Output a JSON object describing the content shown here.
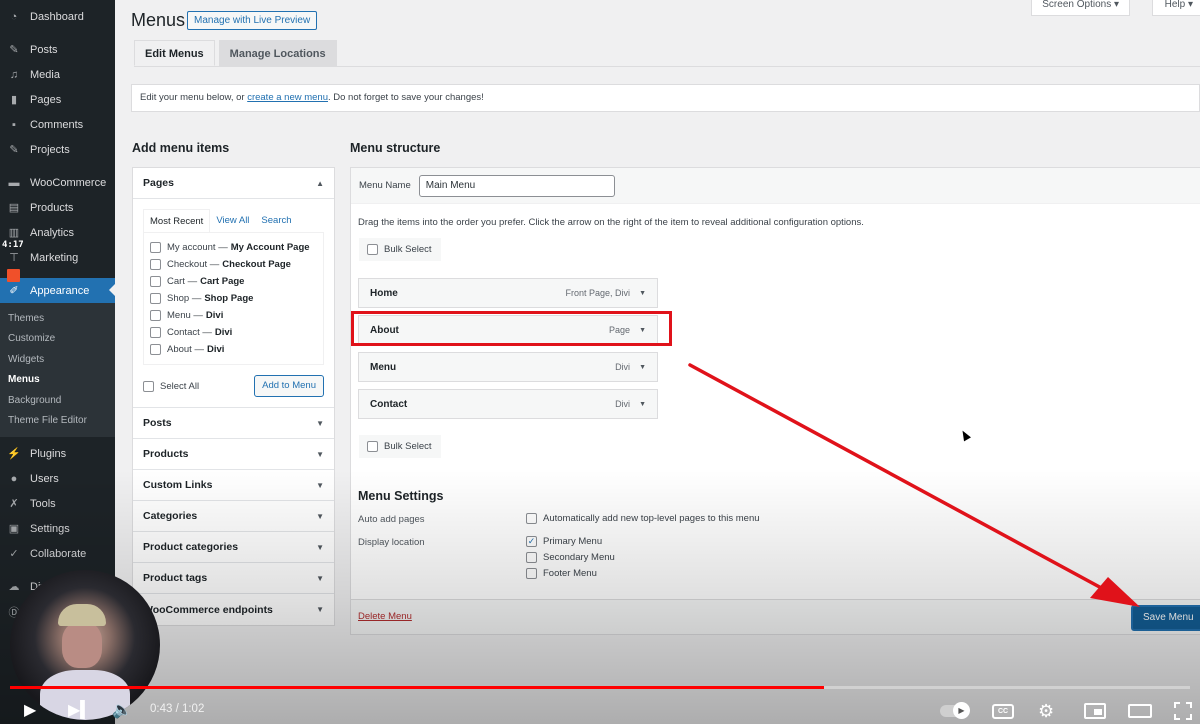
{
  "sidebar": {
    "items": [
      {
        "label": "Dashboard",
        "icon": "dashboard-icon"
      },
      {
        "label": "Posts",
        "icon": "pin-icon"
      },
      {
        "label": "Media",
        "icon": "media-icon"
      },
      {
        "label": "Pages",
        "icon": "pages-icon"
      },
      {
        "label": "Comments",
        "icon": "comment-icon"
      },
      {
        "label": "Projects",
        "icon": "pin-icon"
      },
      {
        "label": "WooCommerce",
        "icon": "woocommerce-icon"
      },
      {
        "label": "Products",
        "icon": "products-icon"
      },
      {
        "label": "Analytics",
        "icon": "bar-chart-icon"
      },
      {
        "label": "Marketing",
        "icon": "megaphone-icon"
      },
      {
        "label": "Appearance",
        "icon": "brush-icon"
      },
      {
        "label": "Plugins",
        "icon": "plugin-icon"
      },
      {
        "label": "Users",
        "icon": "user-icon"
      },
      {
        "label": "Tools",
        "icon": "wrench-icon"
      },
      {
        "label": "Settings",
        "icon": "settings-icon"
      },
      {
        "label": "Collaborate",
        "icon": "check-circle-icon"
      },
      {
        "label": "Divi Cl",
        "icon": "cloud-icon"
      },
      {
        "label": "D",
        "icon": "divi-icon"
      }
    ],
    "submenu": [
      "Themes",
      "Customize",
      "Widgets",
      "Menus",
      "Background",
      "Theme File Editor"
    ],
    "current_sub": "Menus",
    "timer": "4:17"
  },
  "header": {
    "title": "Menus",
    "live_preview": "Manage with Live Preview",
    "screen_options": "Screen Options ▾",
    "help": "Help ▾"
  },
  "tabs": [
    {
      "label": "Edit Menus",
      "active": true
    },
    {
      "label": "Manage Locations",
      "active": false
    }
  ],
  "notice": {
    "before": "Edit your menu below, or ",
    "link": "create a new menu",
    "after": ". Do not forget to save your changes!"
  },
  "add_items": {
    "title": "Add menu items",
    "pages": {
      "label": "Pages",
      "subtabs": [
        "Most Recent",
        "View All",
        "Search"
      ],
      "items": [
        {
          "name": "My account",
          "type": "My Account Page"
        },
        {
          "name": "Checkout",
          "type": "Checkout Page"
        },
        {
          "name": "Cart",
          "type": "Cart Page"
        },
        {
          "name": "Shop",
          "type": "Shop Page"
        },
        {
          "name": "Menu",
          "type": "Divi"
        },
        {
          "name": "Contact",
          "type": "Divi"
        },
        {
          "name": "About",
          "type": "Divi"
        }
      ],
      "select_all": "Select All",
      "add_button": "Add to Menu"
    },
    "sections": [
      "Posts",
      "Products",
      "Custom Links",
      "Categories",
      "Product categories",
      "Product tags",
      "WooCommerce endpoints"
    ]
  },
  "structure": {
    "title": "Menu structure",
    "menu_name_label": "Menu Name",
    "menu_name_value": "Main Menu",
    "hint": "Drag the items into the order you prefer. Click the arrow on the right of the item to reveal additional configuration options.",
    "bulk_select": "Bulk Select",
    "items": [
      {
        "title": "Home",
        "meta": "Front Page, Divi"
      },
      {
        "title": "About",
        "meta": "Page"
      },
      {
        "title": "Menu",
        "meta": "Divi"
      },
      {
        "title": "Contact",
        "meta": "Divi"
      }
    ],
    "highlighted_item": "About",
    "settings": {
      "title": "Menu Settings",
      "auto_add_label": "Auto add pages",
      "auto_add_option": "Automatically add new top-level pages to this menu",
      "auto_add_checked": false,
      "display_label": "Display location",
      "locations": [
        {
          "label": "Primary Menu",
          "checked": true
        },
        {
          "label": "Secondary Menu",
          "checked": false
        },
        {
          "label": "Footer Menu",
          "checked": false
        }
      ]
    },
    "delete_label": "Delete Menu",
    "save_label": "Save Menu"
  },
  "annotation": {
    "color": "#e0121a"
  },
  "player": {
    "current_time": "0:43",
    "duration": "1:02",
    "time_text": "0:43 / 1:02",
    "progress": 0.69,
    "progress_color": "#ff0000"
  }
}
